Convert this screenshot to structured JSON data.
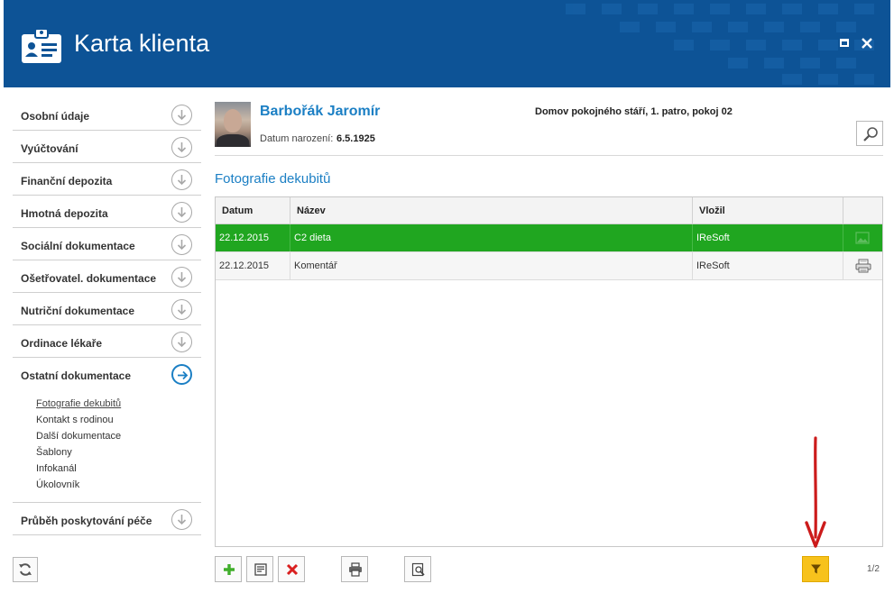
{
  "header": {
    "title": "Karta klienta"
  },
  "sidebar": {
    "items": [
      {
        "label": "Osobní údaje"
      },
      {
        "label": "Vyúčtování"
      },
      {
        "label": "Finanční depozita"
      },
      {
        "label": "Hmotná depozita"
      },
      {
        "label": "Sociální dokumentace"
      },
      {
        "label": "Ošetřovatel. dokumentace"
      },
      {
        "label": "Nutriční dokumentace"
      },
      {
        "label": "Ordinace lékaře"
      },
      {
        "label": "Ostatní dokumentace"
      }
    ],
    "subitems": [
      {
        "label": "Fotografie dekubitů"
      },
      {
        "label": "Kontakt s rodinou"
      },
      {
        "label": "Další dokumentace"
      },
      {
        "label": "Šablony"
      },
      {
        "label": "Infokanál"
      },
      {
        "label": "Úkolovník"
      }
    ],
    "last_item": {
      "label": "Průběh poskytování péče"
    }
  },
  "patient": {
    "name": "Barbořák Jaromír",
    "dob_label": "Datum narození:",
    "dob_value": "6.5.1925",
    "location": "Domov pokojného stáří, 1. patro, pokoj 02"
  },
  "section": {
    "title": "Fotografie dekubitů"
  },
  "table": {
    "columns": [
      "Datum",
      "Název",
      "Vložil"
    ],
    "rows": [
      {
        "date": "22.12.2015",
        "name": "C2 dieta",
        "author": "IReSoft",
        "selected": true
      },
      {
        "date": "22.12.2015",
        "name": "Komentář",
        "author": "IReSoft",
        "selected": false
      }
    ]
  },
  "pager": {
    "text": "1/2"
  },
  "colors": {
    "header_bg": "#0d5396",
    "accent": "#1b7fc4",
    "selected_row": "#20a620",
    "filter_button": "#f7c21c",
    "annotation_arrow": "#cc1b1b"
  }
}
